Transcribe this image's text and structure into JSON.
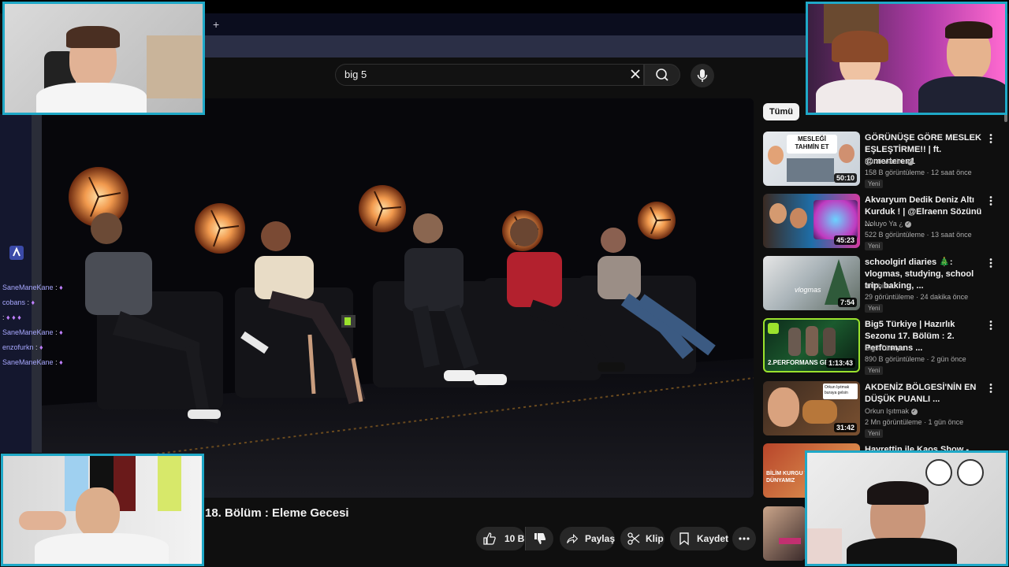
{
  "browser": {
    "new_tab_icon": "+"
  },
  "search": {
    "query": "big 5",
    "placeholder": ""
  },
  "video": {
    "title": "18. Bölüm : Eleme Gecesi"
  },
  "actions": {
    "like_count": "10 B",
    "share_label": "Paylaş",
    "clip_label": "Klip",
    "save_label": "Kaydet"
  },
  "sidebar": {
    "chip_all": "Tümü",
    "recs": [
      {
        "title": "GÖRÜNÜŞE GÖRE MESLEK EŞLEŞTİRME!! | ft. @merteren1",
        "channel": "Burak Aktürk",
        "verified": true,
        "meta": "158 B görüntüleme · 12 saat önce",
        "badge": "Yeni",
        "duration": "50:10",
        "thumb_text": "MESLEĞİ TAHMİN ET"
      },
      {
        "title": "Akvaryum Dedik Deniz Altı Kurduk ! | @Elraenn Sözünü ...",
        "channel": "Noluyo Ya ¿",
        "verified": true,
        "meta": "522 B görüntüleme · 13 saat önce",
        "badge": "Yeni",
        "duration": "45:23",
        "thumb_text": ""
      },
      {
        "title": "schoolgirl diaries 🎄: vlogmas, studying, school trip, baking, ...",
        "channel": "m0chiuu",
        "verified": false,
        "meta": "29 görüntüleme · 24 dakika önce",
        "badge": "Yeni",
        "duration": "7:54",
        "thumb_text": "vlogmas"
      },
      {
        "title": "Big5 Türkiye | Hazırlık Sezonu 17. Bölüm : 2. Performans ...",
        "channel": "Big5 Türkiye",
        "verified": false,
        "meta": "890 B görüntüleme · 2 gün önce",
        "badge": "Yeni",
        "duration": "1:13:43",
        "thumb_text": "2.PERFORMANS GECE"
      },
      {
        "title": "AKDENİZ BÖLGESİ'NİN EN DÜŞÜK PUANLI ...",
        "channel": "Orkun Işıtmak",
        "verified": true,
        "meta": "2 Mn görüntüleme · 1 gün önce",
        "badge": "Yeni",
        "duration": "31:42",
        "thumb_text": "Orkun Işıtmak buraya gelsin"
      },
      {
        "title": "Hayrettin ile Kaos Show -",
        "channel": "",
        "verified": false,
        "meta": "",
        "badge": "",
        "duration": "",
        "thumb_text": "BİLİM KURGU VE DÜNYAMIZ"
      }
    ]
  },
  "chat": [
    {
      "user": "SaneManeKane",
      "msg": ""
    },
    {
      "user": "cobans",
      "msg": ""
    },
    {
      "user": "",
      "msg": ""
    },
    {
      "user": "SaneManeKane",
      "msg": ""
    },
    {
      "user": "enzofurkn",
      "msg": ""
    },
    {
      "user": "SaneManeKane",
      "msg": ""
    }
  ],
  "colors": {
    "accent_cam_border": "#1fa8c7",
    "yt_bg": "#0f0f0f",
    "pill_bg": "#272727"
  }
}
